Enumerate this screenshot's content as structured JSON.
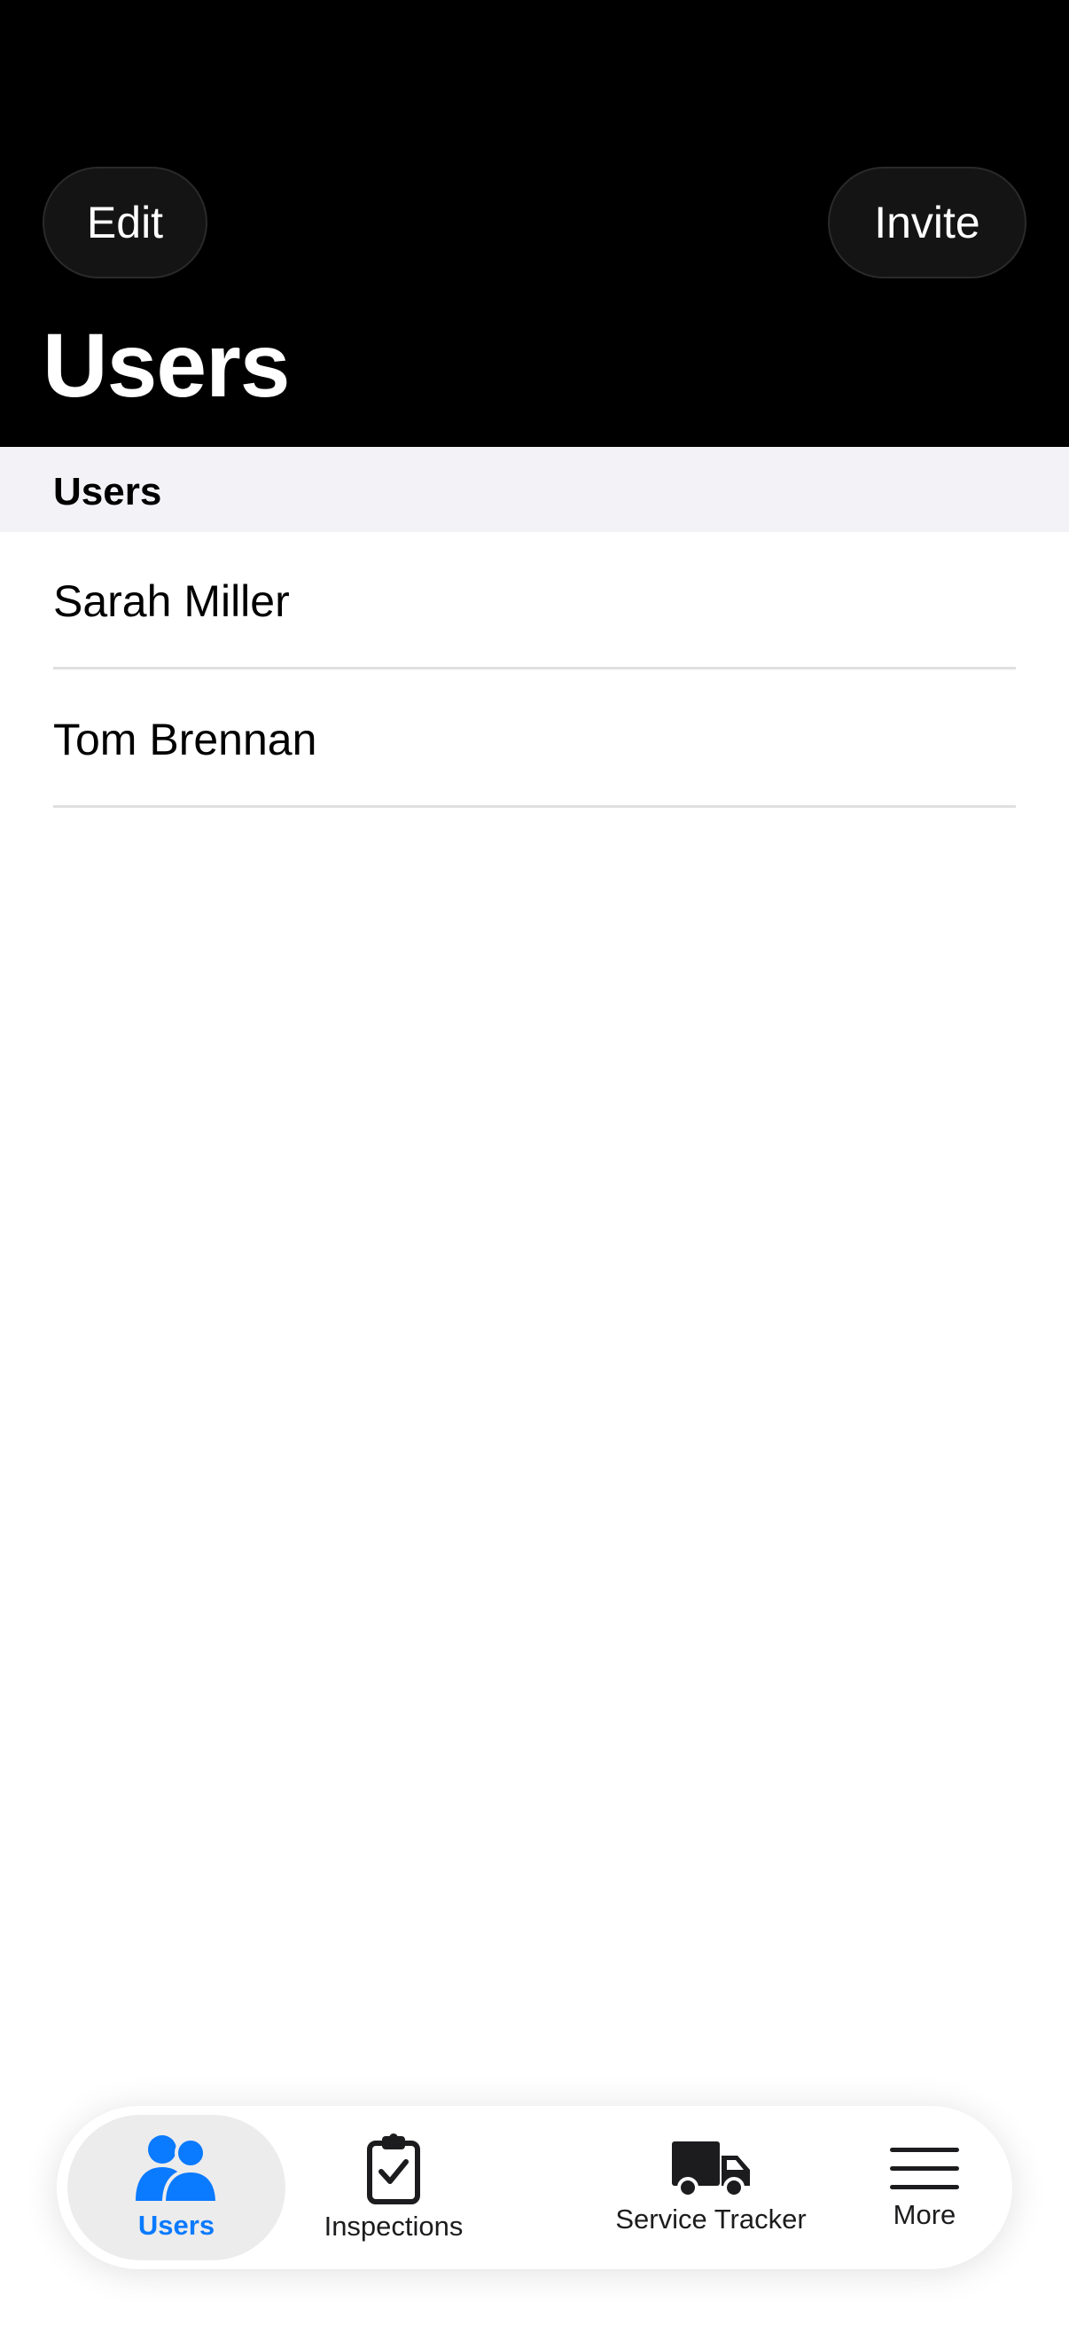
{
  "header": {
    "edit_label": "Edit",
    "invite_label": "Invite",
    "title": "Users"
  },
  "section": {
    "title": "Users"
  },
  "users": [
    {
      "name": "Sarah Miller"
    },
    {
      "name": "Tom Brennan"
    }
  ],
  "tabbar": {
    "tabs": [
      {
        "label": "Users",
        "icon": "users-icon",
        "active": true
      },
      {
        "label": "Inspections",
        "icon": "clipboard-check-icon",
        "active": false
      },
      {
        "label": "Service Tracker",
        "icon": "truck-icon",
        "active": false
      },
      {
        "label": "More",
        "icon": "hamburger-menu-icon",
        "active": false
      }
    ]
  },
  "colors": {
    "accent": "#0a7aff",
    "header_bg": "#000000",
    "section_bg": "#f2f2f7"
  }
}
